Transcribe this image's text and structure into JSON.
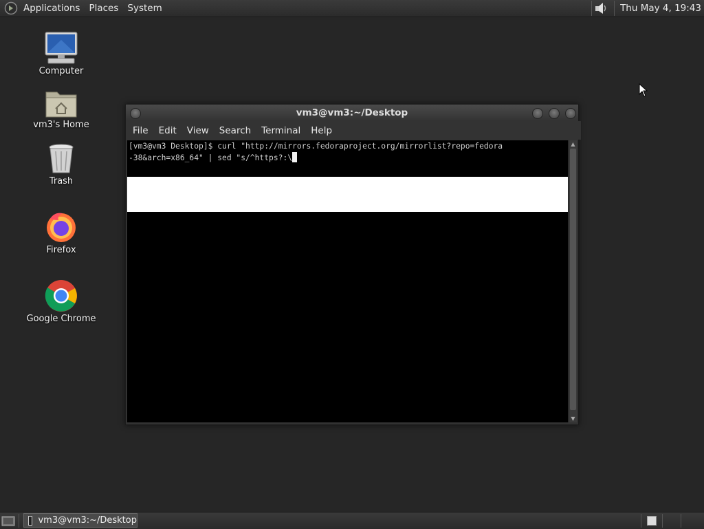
{
  "top_panel": {
    "menus": [
      "Applications",
      "Places",
      "System"
    ],
    "clock": "Thu May  4, 19:43",
    "icons": {
      "logo": "distro-logo-icon",
      "volume": "volume-icon"
    }
  },
  "desktop": {
    "icons": [
      {
        "label": "Computer",
        "icon": "computer-icon"
      },
      {
        "label": "vm3's Home",
        "icon": "home-folder-icon"
      },
      {
        "label": "Trash",
        "icon": "trash-icon"
      },
      {
        "label": "Firefox",
        "icon": "firefox-icon"
      },
      {
        "label": "Google Chrome",
        "icon": "chrome-icon"
      }
    ]
  },
  "terminal": {
    "title": "vm3@vm3:~/Desktop",
    "menu": [
      "File",
      "Edit",
      "View",
      "Search",
      "Terminal",
      "Help"
    ],
    "lines": [
      "[vm3@vm3 Desktop]$ curl \"http://mirrors.fedoraproject.org/mirrorlist?repo=fedora",
      "-38&arch=x86_64\" | sed \"s/^https?:\\"
    ]
  },
  "bottom_panel": {
    "task": "vm3@vm3:~/Desktop",
    "icons": {
      "show_desktop": "show-desktop-icon",
      "workspace": "workspace-switcher-icon"
    }
  },
  "colors": {
    "desktop_bg": "#262626",
    "panel_bg": "#2e2e2e",
    "terminal_bg": "#000000"
  }
}
